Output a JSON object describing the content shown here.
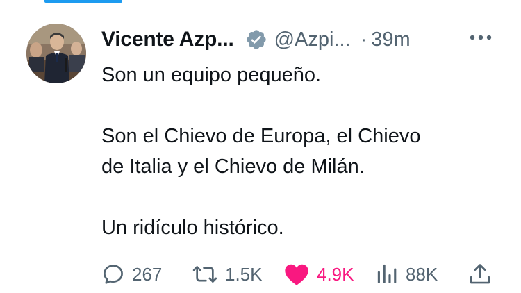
{
  "tweet": {
    "author": {
      "display_name": "Vicente Azp...",
      "handle": "@Azpi...",
      "verified": true,
      "avatar": "avatar-photo"
    },
    "separator": "·",
    "timestamp": "39m",
    "body": [
      "Son un equipo pequeño.",
      "",
      "Son el Chievo de Europa, el Chievo",
      "de Italia y el Chievo de Milán.",
      "",
      "Un ridículo histórico."
    ],
    "actions": {
      "reply": {
        "icon": "reply-icon",
        "count": "267"
      },
      "retweet": {
        "icon": "retweet-icon",
        "count": "1.5K"
      },
      "like": {
        "icon": "heart-icon",
        "count": "4.9K",
        "liked": true
      },
      "views": {
        "icon": "views-icon",
        "count": "88K"
      },
      "share": {
        "icon": "share-icon"
      }
    }
  },
  "colors": {
    "text": "#0f1419",
    "secondary": "#536471",
    "like": "#f91880",
    "accent": "#1d9bf0"
  }
}
